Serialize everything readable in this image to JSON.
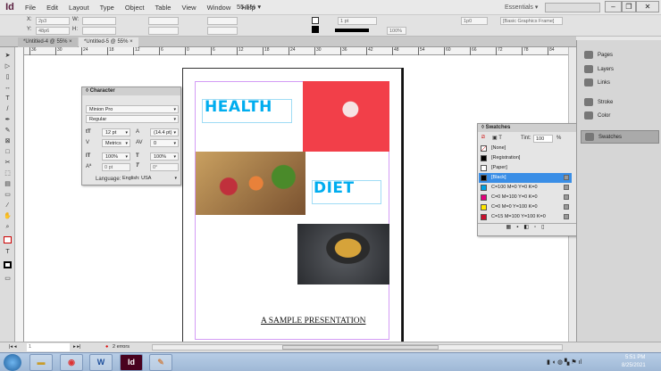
{
  "app": {
    "logo": "Id",
    "zoom": "55.5%",
    "workspace": "Essentials",
    "menus": [
      "File",
      "Edit",
      "Layout",
      "Type",
      "Object",
      "Table",
      "View",
      "Window",
      "Help"
    ]
  },
  "control": {
    "x_label": "X:",
    "x_value": "2p3",
    "y_label": "Y:",
    "y_value": "48p6",
    "w_label": "W:",
    "h_label": "H:",
    "stroke_weight": "1 pt",
    "opacity": "100%",
    "offset": "1p0",
    "object_style": "[Basic Graphics Frame]"
  },
  "tabs": [
    {
      "label": "*Untitled-4 @ 55%"
    },
    {
      "label": "*Untitled-5 @ 55%"
    }
  ],
  "ruler": [
    "36",
    "30",
    "24",
    "18",
    "12",
    "6",
    "0",
    "6",
    "12",
    "18",
    "24",
    "30",
    "36",
    "42",
    "48",
    "54",
    "60",
    "66",
    "72",
    "78",
    "84"
  ],
  "document": {
    "title1": "HEALTH",
    "title2": "DIET",
    "subtitle": "A SAMPLE PRESENTATION"
  },
  "character": {
    "title": "Character",
    "font": "Minion Pro",
    "style": "Regular",
    "size": "12 pt",
    "leading": "(14.4 pt)",
    "kerning": "Metrics",
    "tracking": "0",
    "vscale": "100%",
    "hscale": "100%",
    "baseline": "0 pt",
    "skew": "0°",
    "language_label": "Language:",
    "language": "English: USA"
  },
  "swatches": {
    "title": "Swatches",
    "tint_label": "Tint:",
    "tint": "100",
    "pct": "%",
    "items": [
      {
        "name": "[None]",
        "color": "#ffffff"
      },
      {
        "name": "[Registration]",
        "color": "#000000"
      },
      {
        "name": "[Paper]",
        "color": "#ffffff"
      },
      {
        "name": "[Black]",
        "color": "#000000",
        "selected": true
      },
      {
        "name": "C=100 M=0 Y=0 K=0",
        "color": "#00a0e3"
      },
      {
        "name": "C=0 M=100 Y=0 K=0",
        "color": "#e4007c"
      },
      {
        "name": "C=0 M=0 Y=100 K=0",
        "color": "#ffe600"
      },
      {
        "name": "C=15 M=100 Y=100 K=0",
        "color": "#c8102e"
      }
    ]
  },
  "dock": [
    "Pages",
    "Layers",
    "Links",
    "Stroke",
    "Color",
    "Swatches"
  ],
  "status": {
    "page": "1",
    "errors": "2 errors"
  },
  "taskbar": {
    "time": "5:51 PM",
    "date": "8/25/2021"
  }
}
